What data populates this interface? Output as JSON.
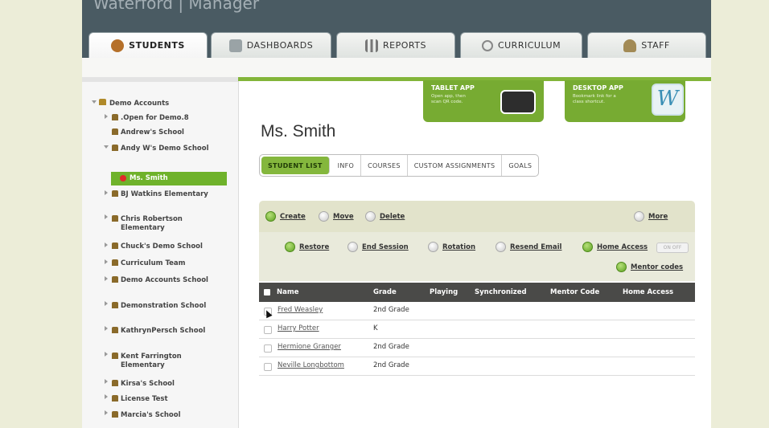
{
  "app": {
    "brand": "Waterford | Manager"
  },
  "tabs": [
    {
      "label": "STUDENTS",
      "active": true,
      "icon": "apple-icon"
    },
    {
      "label": "DASHBOARDS",
      "active": false,
      "icon": "people-icon"
    },
    {
      "label": "REPORTS",
      "active": false,
      "icon": "bar-chart-icon"
    },
    {
      "label": "CURRICULUM",
      "active": false,
      "icon": "magnifier-icon"
    },
    {
      "label": "STAFF",
      "active": false,
      "icon": "person-icon"
    }
  ],
  "tree": {
    "root": "Demo Accounts",
    "items": [
      {
        "label": ".Open for Demo.8"
      },
      {
        "label": "Andrew's School"
      },
      {
        "label": "Andy W's Demo School"
      },
      {
        "label": "Ms. Smith"
      },
      {
        "label": "BJ Watkins Elementary"
      },
      {
        "label": "Chris Robertson Elementary"
      },
      {
        "label": "Chuck's Demo School"
      },
      {
        "label": "Curriculum Team"
      },
      {
        "label": "Demo Accounts School"
      },
      {
        "label": "Demonstration School"
      },
      {
        "label": "KathrynPersch School"
      },
      {
        "label": "Kent Farrington Elementary"
      },
      {
        "label": "Kirsa's School"
      },
      {
        "label": "License Test"
      },
      {
        "label": "Marcia's School"
      }
    ]
  },
  "promos": {
    "tablet": {
      "title": "TABLET APP",
      "desc": "Open app, then scan QR code."
    },
    "desktop": {
      "title": "DESKTOP APP",
      "desc": "Bookmark link for a class shortcut."
    }
  },
  "page": {
    "title": "Ms. Smith"
  },
  "subtabs": [
    "STUDENT LIST",
    "INFO",
    "COURSES",
    "CUSTOM ASSIGNMENTS",
    "GOALS"
  ],
  "toolbar": {
    "create": "Create",
    "move": "Move",
    "delete": "Delete",
    "more": "More",
    "restore": "Restore",
    "end_session": "End Session",
    "rotation": "Rotation",
    "resend_email": "Resend Email",
    "home_access": "Home Access",
    "toggle": "ON OFF",
    "mentor_codes": "Mentor codes"
  },
  "table": {
    "columns": [
      "Name",
      "Grade",
      "Playing",
      "Synchronized",
      "Mentor Code",
      "Home Access"
    ],
    "rows": [
      {
        "name": "Fred Weasley",
        "grade": "2nd Grade"
      },
      {
        "name": "Harry Potter",
        "grade": "K"
      },
      {
        "name": "Hermione Granger",
        "grade": "2nd Grade"
      },
      {
        "name": "Neville Longbottom",
        "grade": "2nd Grade"
      }
    ]
  },
  "colors": {
    "accent_green": "#83b53a",
    "header": "#4a5b63",
    "table_header": "#4a4a48"
  }
}
